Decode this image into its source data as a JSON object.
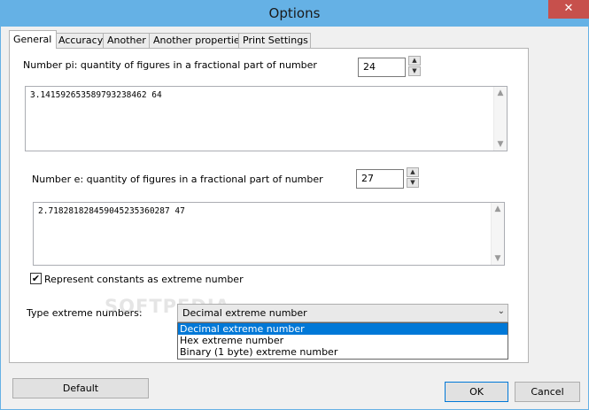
{
  "window": {
    "title": "Options",
    "close_glyph": "✕",
    "accent": "#65b1e5",
    "close_color": "#c7504c"
  },
  "tabs": [
    {
      "label": "General",
      "active": true
    },
    {
      "label": "Accuracy",
      "active": false
    },
    {
      "label": "Another",
      "active": false
    },
    {
      "label": "Another properties",
      "active": false
    },
    {
      "label": "Print Settings",
      "active": false
    }
  ],
  "general": {
    "pi": {
      "label": "Number pi: quantity of figures in a fractional part of number",
      "value": "24",
      "text": "3.141592653589793238462 64"
    },
    "e": {
      "label": "Number e: quantity of figures in a fractional part of number",
      "value": "27",
      "text": "2.718281828459045235360287 47"
    },
    "represent_extreme": {
      "label": "Represent constants as extreme number",
      "checked": true,
      "check_glyph": "✔"
    },
    "type_extreme": {
      "label": "Type extreme numbers:",
      "selected": "Decimal extreme number",
      "options": [
        "Decimal extreme number",
        "Hex extreme number",
        "Binary (1 byte) extreme number"
      ]
    }
  },
  "watermark": "SOFTPEDIA",
  "footer": {
    "default_label": "Default",
    "ok_label": "OK",
    "cancel_label": "Cancel"
  },
  "icons": {
    "spin_up": "▲",
    "spin_down": "▼",
    "scroll_up": "▲",
    "scroll_down": "▼",
    "combo_arrow": "⌄"
  }
}
